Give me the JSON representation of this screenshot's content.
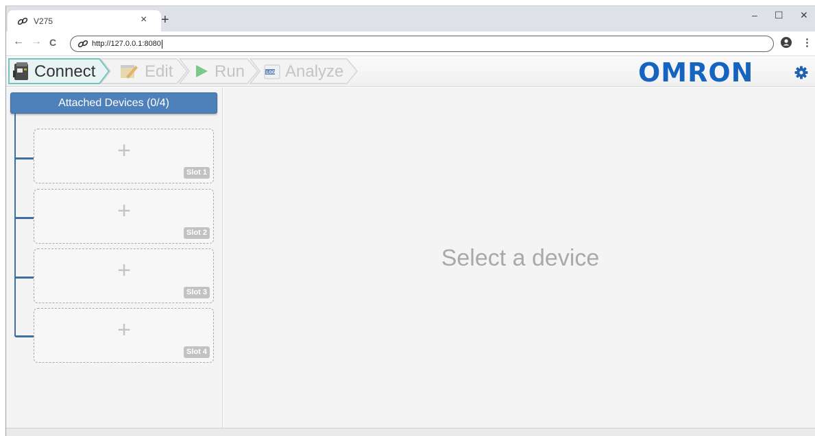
{
  "browser": {
    "tab_title": "V275",
    "tab_close": "×",
    "new_tab": "+",
    "window_controls": {
      "minimize": "–",
      "maximize": "☐",
      "close": "✕"
    },
    "nav": {
      "back": "←",
      "forward": "→",
      "reload": "C"
    },
    "url": "http://127.0.0.1:8080",
    "menu": "⋮",
    "icons": {
      "tab": "link-icon",
      "omnibox": "link-icon",
      "account": "account-icon"
    }
  },
  "app": {
    "workflow": [
      {
        "label": "Connect",
        "icon": "printer-icon",
        "active": true
      },
      {
        "label": "Edit",
        "icon": "edit-icon",
        "active": false
      },
      {
        "label": "Run",
        "icon": "play-icon",
        "active": false
      },
      {
        "label": "Analyze",
        "icon": "log-icon",
        "active": false
      }
    ],
    "logo": "OMRON",
    "settings_icon": "gear-icon",
    "accent_color": "#4e81b9",
    "logo_color": "#1565c0"
  },
  "sidebar": {
    "header": "Attached Devices (0/4)",
    "slots": [
      {
        "plus": "+",
        "label": "Slot 1"
      },
      {
        "plus": "+",
        "label": "Slot 2"
      },
      {
        "plus": "+",
        "label": "Slot 3"
      },
      {
        "plus": "+",
        "label": "Slot 4"
      }
    ]
  },
  "main": {
    "placeholder": "Select a device"
  }
}
